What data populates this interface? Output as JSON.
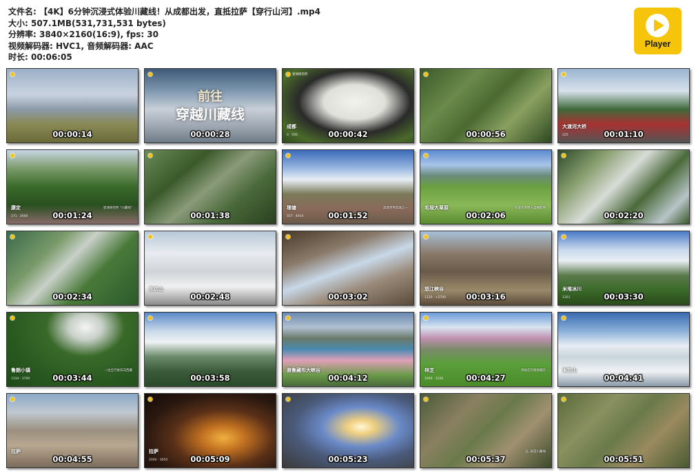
{
  "info": {
    "file_name": "文件名: 【4K】6分钟沉浸式体验川藏线！从成都出发，直抵拉萨【穿行山河】.mp4",
    "size": "大小: 507.1MB(531,731,531 bytes)",
    "resolution": "分辨率: 3840×2160(16:9), fps: 30",
    "codec": "视频解码器: HVC1, 音频解码器: AAC",
    "duration": "时长: 00:06:05"
  },
  "logo": {
    "label": "Player",
    "color": "#f6c40b",
    "icon": "play-icon"
  },
  "brand_text": "星球研究所",
  "overlay": {
    "line1": "前往",
    "line2": "穿越川藏线"
  },
  "thumbnails": [
    {
      "time": "00:00:14",
      "loc": "",
      "sub": "",
      "note": ""
    },
    {
      "time": "00:00:28",
      "loc": "",
      "sub": "",
      "note": ""
    },
    {
      "time": "00:00:42",
      "loc": "成都",
      "sub": "0 · 500",
      "note": ""
    },
    {
      "time": "00:00:56",
      "loc": "",
      "sub": "",
      "note": ""
    },
    {
      "time": "00:01:10",
      "loc": "大渡河大桥",
      "sub": "225",
      "note": ""
    },
    {
      "time": "00:01:24",
      "loc": "康定",
      "sub": "271 · 2600",
      "note": "星球研究所 “川藏线”"
    },
    {
      "time": "00:01:38",
      "loc": "",
      "sub": "",
      "note": ""
    },
    {
      "time": "00:01:52",
      "loc": "理塘",
      "sub": "557 · 4014",
      "note": "高城世界高城之一"
    },
    {
      "time": "00:02:06",
      "loc": "毛垭大草原",
      "sub": "",
      "note": "毛垭大草原人类摄影地"
    },
    {
      "time": "00:02:20",
      "loc": "",
      "sub": "",
      "note": ""
    },
    {
      "time": "00:02:34",
      "loc": "",
      "sub": "",
      "note": ""
    },
    {
      "time": "00:02:48",
      "loc": "东达山",
      "sub": "",
      "note": ""
    },
    {
      "time": "00:03:02",
      "loc": "",
      "sub": "",
      "note": ""
    },
    {
      "time": "00:03:16",
      "loc": "怒江峡谷",
      "sub": "1120 · +2700",
      "note": ""
    },
    {
      "time": "00:03:30",
      "loc": "米堆冰川",
      "sub": "1261",
      "note": ""
    },
    {
      "time": "00:03:44",
      "loc": "鲁朗小镇",
      "sub": "1334 · 3700",
      "note": "一边全行驶双向西藏"
    },
    {
      "time": "00:03:58",
      "loc": "",
      "sub": "",
      "note": ""
    },
    {
      "time": "00:04:12",
      "loc": "雅鲁藏布大峡谷",
      "sub": "",
      "note": ""
    },
    {
      "time": "00:04:27",
      "loc": "林芝",
      "sub": "1600 · 3100",
      "note": "海拔还有随地摄升"
    },
    {
      "time": "00:04:41",
      "loc": "米拉山",
      "sub": "",
      "note": ""
    },
    {
      "time": "00:04:55",
      "loc": "拉萨",
      "sub": "",
      "note": ""
    },
    {
      "time": "00:05:09",
      "loc": "拉萨",
      "sub": "2000 · 3650",
      "note": ""
    },
    {
      "time": "00:05:23",
      "loc": "",
      "sub": "",
      "note": ""
    },
    {
      "time": "00:05:37",
      "loc": "",
      "sub": "",
      "note": "这, 就是川藏线"
    },
    {
      "time": "00:05:51",
      "loc": "",
      "sub": "",
      "note": ""
    }
  ]
}
